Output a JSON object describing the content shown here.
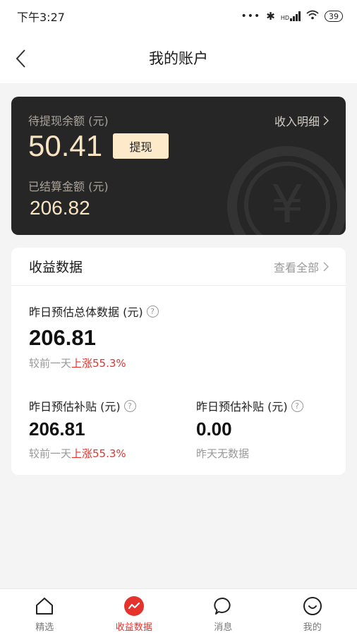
{
  "status_bar": {
    "time": "下午3:27",
    "network": "HD",
    "battery": "39"
  },
  "header": {
    "title": "我的账户"
  },
  "balance": {
    "pending_label": "待提现余额 (元)",
    "pending_amount": "50.41",
    "withdraw_label": "提现",
    "income_detail_label": "收入明细",
    "settled_label": "已结算金额 (元)",
    "settled_amount": "206.82"
  },
  "earnings": {
    "title": "收益数据",
    "view_all_label": "查看全部",
    "total": {
      "label": "昨日预估总体数据 (元)",
      "value": "206.81",
      "compare_prefix": "较前一天",
      "compare_change": "上涨55.3%"
    },
    "subsidy_left": {
      "label": "昨日预估补贴 (元)",
      "value": "206.81",
      "compare_prefix": "较前一天",
      "compare_change": "上涨55.3%"
    },
    "subsidy_right": {
      "label": "昨日预估补贴 (元)",
      "value": "0.00",
      "note": "昨天无数据"
    }
  },
  "tabs": [
    {
      "label": "精选",
      "icon": "home-icon",
      "active": false
    },
    {
      "label": "收益数据",
      "icon": "earnings-icon",
      "active": true
    },
    {
      "label": "消息",
      "icon": "message-icon",
      "active": false
    },
    {
      "label": "我的",
      "icon": "profile-icon",
      "active": false
    }
  ],
  "colors": {
    "accent": "#e5322d",
    "card_dark": "#262626",
    "gold_text": "#f6e4c3",
    "button_gold": "#fdeacb"
  }
}
